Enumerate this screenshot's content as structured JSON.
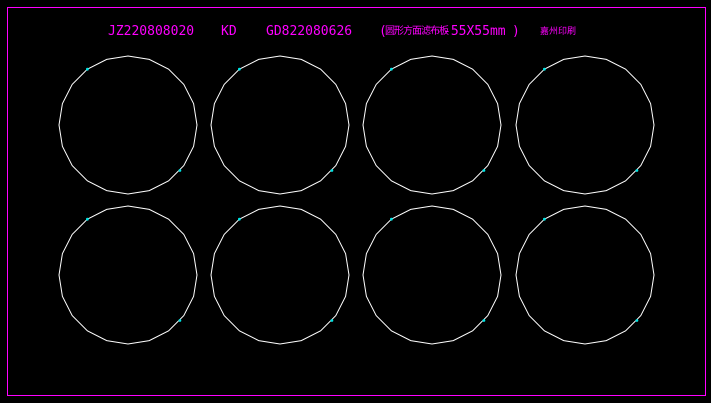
{
  "canvas": {
    "background_color": "#000000",
    "frame_color": "#ff00ff",
    "outline_color": "#ffffff",
    "marker_color": "#00e5e5"
  },
  "title": {
    "part_code": "JZ220808020",
    "process_code": "KD",
    "order_code": "GD822080626",
    "paren_open": "(",
    "spec_label": "圆形方面滤布板",
    "spec_size": "-55X55mm",
    "paren_close": ")",
    "maker_label": "嘉州印刷"
  },
  "drawing": {
    "rows": 2,
    "columns": 4,
    "shape": "circle"
  }
}
